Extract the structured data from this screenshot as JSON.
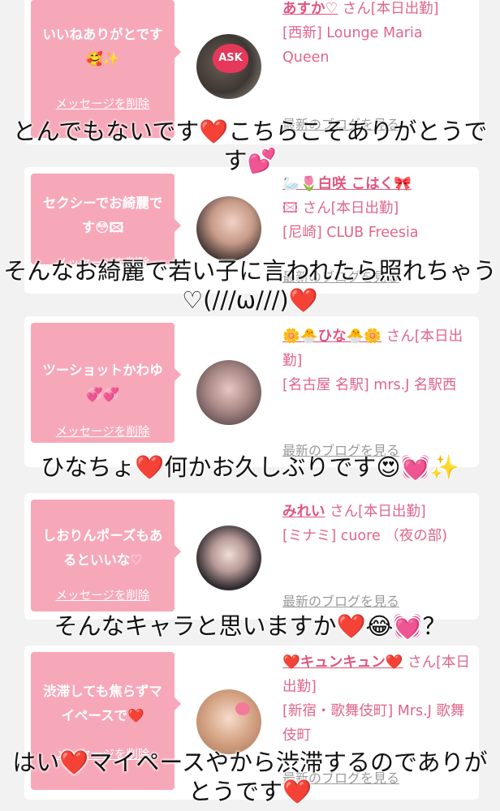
{
  "cards": [
    {
      "message": "いいねありがとです🥰✨",
      "delete_label": "メッセージを削除",
      "name": "あすか♡",
      "san": "さん[本日出勤]",
      "store": "[西新] Lounge Maria Queen",
      "blog_label": "最新のブログを見る",
      "avatar_badge": "ASK"
    },
    {
      "message": "セクシーでお綺麗です😳🖾",
      "delete_label": "メッセージを削除",
      "name": "🦢🌷白咲 こはく🎀",
      "san": "🖾 さん[本日出勤]",
      "store": "[尼崎] CLUB Freesia",
      "blog_label": "最新のブログを見る"
    },
    {
      "message": "ツーショットかわゆ💞💞",
      "delete_label": "メッセージを削除",
      "name": "🌼🐣ひな🐣🌼",
      "san": "さん[本日出勤]",
      "store": "[名古屋 名駅] mrs.J 名駅西",
      "blog_label": "最新のブログを見る"
    },
    {
      "message": "しおりんポーズもあるといいな♡",
      "delete_label": "メッセージを削除",
      "name": "みれい",
      "san": "さん[本日出勤]",
      "store": "[ミナミ] cuore （夜の部)",
      "blog_label": "最新のブログを見る"
    },
    {
      "message": "渋滞しても焦らずマイペースで❤️",
      "delete_label": "メッセージを削除",
      "name": "❤️キュンキュン❤️",
      "san": "さん[本日出勤]",
      "store": "[新宿・歌舞伎町] Mrs.J 歌舞伎町",
      "blog_label": "最新のブログを見る"
    }
  ],
  "captions": [
    "とんでもないです❤️こちらこそありがとうです💕",
    "そんなお綺麗で若い子に言われたら照れちゃう♡(///ω///)❤️",
    "ひなちょ❤️何かお久しぶりです😍💓✨",
    "そんなキャラと思いますか❤️😂💓？",
    "はい❤️マイペースやから渋滞するのでありがとうです❤️"
  ],
  "colors": {
    "bubble": "#f7a8b8",
    "name": "#e0557f",
    "text_pink": "#e0658a",
    "background": "#f2f2f2"
  }
}
